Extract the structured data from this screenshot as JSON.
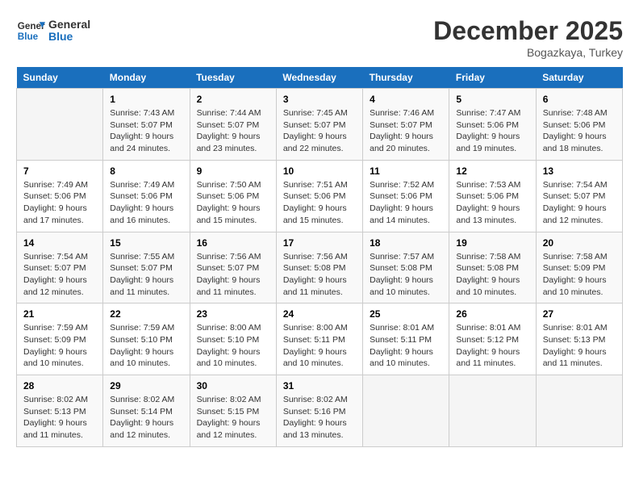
{
  "logo": {
    "line1": "General",
    "line2": "Blue"
  },
  "title": "December 2025",
  "subtitle": "Bogazkaya, Turkey",
  "header_days": [
    "Sunday",
    "Monday",
    "Tuesday",
    "Wednesday",
    "Thursday",
    "Friday",
    "Saturday"
  ],
  "weeks": [
    [
      {
        "day": "",
        "info": ""
      },
      {
        "day": "1",
        "info": "Sunrise: 7:43 AM\nSunset: 5:07 PM\nDaylight: 9 hours\nand 24 minutes."
      },
      {
        "day": "2",
        "info": "Sunrise: 7:44 AM\nSunset: 5:07 PM\nDaylight: 9 hours\nand 23 minutes."
      },
      {
        "day": "3",
        "info": "Sunrise: 7:45 AM\nSunset: 5:07 PM\nDaylight: 9 hours\nand 22 minutes."
      },
      {
        "day": "4",
        "info": "Sunrise: 7:46 AM\nSunset: 5:07 PM\nDaylight: 9 hours\nand 20 minutes."
      },
      {
        "day": "5",
        "info": "Sunrise: 7:47 AM\nSunset: 5:06 PM\nDaylight: 9 hours\nand 19 minutes."
      },
      {
        "day": "6",
        "info": "Sunrise: 7:48 AM\nSunset: 5:06 PM\nDaylight: 9 hours\nand 18 minutes."
      }
    ],
    [
      {
        "day": "7",
        "info": "Sunrise: 7:49 AM\nSunset: 5:06 PM\nDaylight: 9 hours\nand 17 minutes."
      },
      {
        "day": "8",
        "info": "Sunrise: 7:49 AM\nSunset: 5:06 PM\nDaylight: 9 hours\nand 16 minutes."
      },
      {
        "day": "9",
        "info": "Sunrise: 7:50 AM\nSunset: 5:06 PM\nDaylight: 9 hours\nand 15 minutes."
      },
      {
        "day": "10",
        "info": "Sunrise: 7:51 AM\nSunset: 5:06 PM\nDaylight: 9 hours\nand 15 minutes."
      },
      {
        "day": "11",
        "info": "Sunrise: 7:52 AM\nSunset: 5:06 PM\nDaylight: 9 hours\nand 14 minutes."
      },
      {
        "day": "12",
        "info": "Sunrise: 7:53 AM\nSunset: 5:06 PM\nDaylight: 9 hours\nand 13 minutes."
      },
      {
        "day": "13",
        "info": "Sunrise: 7:54 AM\nSunset: 5:07 PM\nDaylight: 9 hours\nand 12 minutes."
      }
    ],
    [
      {
        "day": "14",
        "info": "Sunrise: 7:54 AM\nSunset: 5:07 PM\nDaylight: 9 hours\nand 12 minutes."
      },
      {
        "day": "15",
        "info": "Sunrise: 7:55 AM\nSunset: 5:07 PM\nDaylight: 9 hours\nand 11 minutes."
      },
      {
        "day": "16",
        "info": "Sunrise: 7:56 AM\nSunset: 5:07 PM\nDaylight: 9 hours\nand 11 minutes."
      },
      {
        "day": "17",
        "info": "Sunrise: 7:56 AM\nSunset: 5:08 PM\nDaylight: 9 hours\nand 11 minutes."
      },
      {
        "day": "18",
        "info": "Sunrise: 7:57 AM\nSunset: 5:08 PM\nDaylight: 9 hours\nand 10 minutes."
      },
      {
        "day": "19",
        "info": "Sunrise: 7:58 AM\nSunset: 5:08 PM\nDaylight: 9 hours\nand 10 minutes."
      },
      {
        "day": "20",
        "info": "Sunrise: 7:58 AM\nSunset: 5:09 PM\nDaylight: 9 hours\nand 10 minutes."
      }
    ],
    [
      {
        "day": "21",
        "info": "Sunrise: 7:59 AM\nSunset: 5:09 PM\nDaylight: 9 hours\nand 10 minutes."
      },
      {
        "day": "22",
        "info": "Sunrise: 7:59 AM\nSunset: 5:10 PM\nDaylight: 9 hours\nand 10 minutes."
      },
      {
        "day": "23",
        "info": "Sunrise: 8:00 AM\nSunset: 5:10 PM\nDaylight: 9 hours\nand 10 minutes."
      },
      {
        "day": "24",
        "info": "Sunrise: 8:00 AM\nSunset: 5:11 PM\nDaylight: 9 hours\nand 10 minutes."
      },
      {
        "day": "25",
        "info": "Sunrise: 8:01 AM\nSunset: 5:11 PM\nDaylight: 9 hours\nand 10 minutes."
      },
      {
        "day": "26",
        "info": "Sunrise: 8:01 AM\nSunset: 5:12 PM\nDaylight: 9 hours\nand 11 minutes."
      },
      {
        "day": "27",
        "info": "Sunrise: 8:01 AM\nSunset: 5:13 PM\nDaylight: 9 hours\nand 11 minutes."
      }
    ],
    [
      {
        "day": "28",
        "info": "Sunrise: 8:02 AM\nSunset: 5:13 PM\nDaylight: 9 hours\nand 11 minutes."
      },
      {
        "day": "29",
        "info": "Sunrise: 8:02 AM\nSunset: 5:14 PM\nDaylight: 9 hours\nand 12 minutes."
      },
      {
        "day": "30",
        "info": "Sunrise: 8:02 AM\nSunset: 5:15 PM\nDaylight: 9 hours\nand 12 minutes."
      },
      {
        "day": "31",
        "info": "Sunrise: 8:02 AM\nSunset: 5:16 PM\nDaylight: 9 hours\nand 13 minutes."
      },
      {
        "day": "",
        "info": ""
      },
      {
        "day": "",
        "info": ""
      },
      {
        "day": "",
        "info": ""
      }
    ]
  ]
}
